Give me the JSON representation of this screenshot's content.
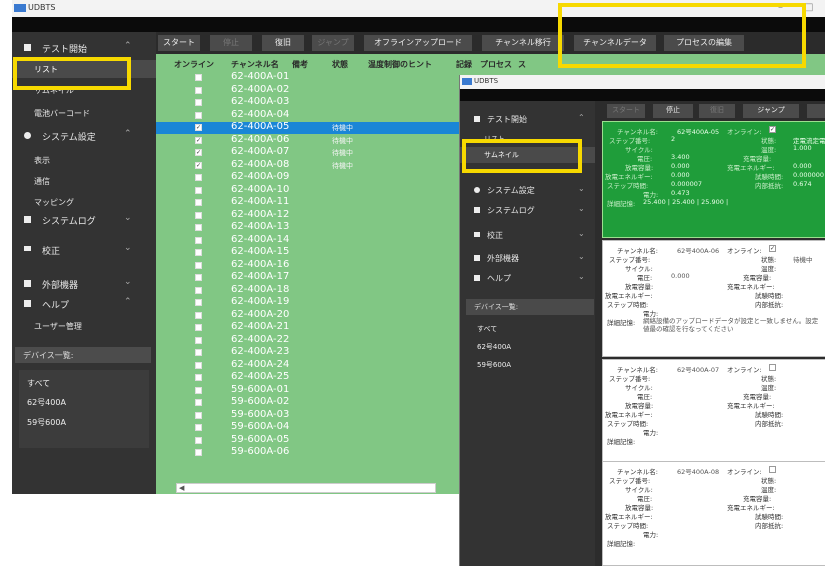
{
  "window": {
    "app_title": "UDBTS"
  },
  "sidebar": {
    "sections": [
      {
        "label": "テスト開始",
        "expanded": true
      },
      {
        "label": "システム設定",
        "expanded": true
      },
      {
        "label": "システムログ",
        "expanded": false
      },
      {
        "label": "校正",
        "expanded": false
      },
      {
        "label": "外部機器",
        "expanded": false
      },
      {
        "label": "ヘルプ",
        "expanded": true
      }
    ],
    "test_items": [
      "リスト",
      "サムネイル",
      "電池バーコード"
    ],
    "settings_items": [
      "表示",
      "通信",
      "マッピング"
    ],
    "help_items": [
      "ユーザー管理"
    ],
    "device_list_title": "デバイス一覧:",
    "devices": [
      "すべて",
      "62号400A",
      "59号600A"
    ]
  },
  "toolbar": {
    "buttons": [
      "スタート",
      "停止",
      "復旧",
      "ジャンプ",
      "オフラインアップロード",
      "チャンネル移行",
      "チャンネルデータ",
      "プロセスの編集"
    ]
  },
  "table": {
    "columns": [
      "オンライン",
      "チャンネル名",
      "備考",
      "状態",
      "温度制御のヒント",
      "記録",
      "プロセス",
      "ス"
    ],
    "rows": [
      {
        "name": "62-400A-01",
        "checked": false,
        "status": "",
        "selected": false
      },
      {
        "name": "62-400A-02",
        "checked": false,
        "status": "",
        "selected": false
      },
      {
        "name": "62-400A-03",
        "checked": false,
        "status": "",
        "selected": false
      },
      {
        "name": "62-400A-04",
        "checked": false,
        "status": "",
        "selected": false
      },
      {
        "name": "62-400A-05",
        "checked": true,
        "status": "待機中",
        "selected": true
      },
      {
        "name": "62-400A-06",
        "checked": true,
        "status": "待機中",
        "selected": false
      },
      {
        "name": "62-400A-07",
        "checked": true,
        "status": "待機中",
        "selected": false
      },
      {
        "name": "62-400A-08",
        "checked": true,
        "status": "待機中",
        "selected": false
      },
      {
        "name": "62-400A-09",
        "checked": false,
        "status": "",
        "selected": false
      },
      {
        "name": "62-400A-10",
        "checked": false,
        "status": "",
        "selected": false
      },
      {
        "name": "62-400A-11",
        "checked": false,
        "status": "",
        "selected": false
      },
      {
        "name": "62-400A-12",
        "checked": false,
        "status": "",
        "selected": false
      },
      {
        "name": "62-400A-13",
        "checked": false,
        "status": "",
        "selected": false
      },
      {
        "name": "62-400A-14",
        "checked": false,
        "status": "",
        "selected": false
      },
      {
        "name": "62-400A-15",
        "checked": false,
        "status": "",
        "selected": false
      },
      {
        "name": "62-400A-16",
        "checked": false,
        "status": "",
        "selected": false
      },
      {
        "name": "62-400A-17",
        "checked": false,
        "status": "",
        "selected": false
      },
      {
        "name": "62-400A-18",
        "checked": false,
        "status": "",
        "selected": false
      },
      {
        "name": "62-400A-19",
        "checked": false,
        "status": "",
        "selected": false
      },
      {
        "name": "62-400A-20",
        "checked": false,
        "status": "",
        "selected": false
      },
      {
        "name": "62-400A-21",
        "checked": false,
        "status": "",
        "selected": false
      },
      {
        "name": "62-400A-22",
        "checked": false,
        "status": "",
        "selected": false
      },
      {
        "name": "62-400A-23",
        "checked": false,
        "status": "",
        "selected": false
      },
      {
        "name": "62-400A-24",
        "checked": false,
        "status": "",
        "selected": false
      },
      {
        "name": "62-400A-25",
        "checked": false,
        "status": "",
        "selected": false
      },
      {
        "name": "59-600A-01",
        "checked": false,
        "status": "",
        "selected": false
      },
      {
        "name": "59-600A-02",
        "checked": false,
        "status": "",
        "selected": false
      },
      {
        "name": "59-600A-03",
        "checked": false,
        "status": "",
        "selected": false
      },
      {
        "name": "59-600A-04",
        "checked": false,
        "status": "",
        "selected": false
      },
      {
        "name": "59-600A-05",
        "checked": false,
        "status": "",
        "selected": false
      },
      {
        "name": "59-600A-06",
        "checked": false,
        "status": "",
        "selected": false
      }
    ]
  },
  "overlay": {
    "app_title": "UDBTS",
    "sections": [
      {
        "label": "テスト開始"
      },
      {
        "label": "システム設定"
      },
      {
        "label": "システムログ"
      },
      {
        "label": "校正"
      },
      {
        "label": "外部機器"
      },
      {
        "label": "ヘルプ"
      }
    ],
    "test_items": [
      "リスト",
      "サムネイル"
    ],
    "device_list_title": "デバイス一覧:",
    "devices": [
      "すべて",
      "62号400A",
      "59号600A"
    ],
    "toolbar_buttons": [
      "スタート",
      "停止",
      "復旧",
      "ジャンプ"
    ],
    "labels": {
      "channel_name": "チャンネル名:",
      "online": "オンライン:",
      "step_no": "ステップ番号:",
      "status": "状態:",
      "cycle": "サイクル:",
      "temperature": "温度:",
      "voltage": "電圧:",
      "charge_capacity": "充電容量:",
      "discharge_capacity": "放電容量:",
      "charge_energy": "充電エネルギー:",
      "discharge_energy": "放電エネルギー:",
      "elapsed_time": "試験時間:",
      "step_time": "ステップ時間:",
      "internal_resistance": "内部抵抗:",
      "power": "電力:",
      "detail": "詳細記憶:"
    },
    "cards": [
      {
        "channel": "62号400A-05",
        "online": true,
        "step": "2",
        "status": "定電流定電",
        "cycle": "",
        "temperature": "1.000",
        "voltage": "3.400",
        "charge_capacity": "",
        "discharge_capacity": "0.000",
        "charge_energy": "0.000",
        "discharge_energy": "0.000",
        "elapsed_time": "0.000000",
        "step_time": "0.000007",
        "internal_resistance": "0.674",
        "power": "0.473",
        "detail": "25.400 | 25.400 | 25.900 |",
        "active": true
      },
      {
        "channel": "62号400A-06",
        "online": true,
        "status": "待機中",
        "voltage": "0.000",
        "detail": "網絡設備のアップロードデータが設定と一致しません。設定値最の確認を行なってください",
        "active": false
      },
      {
        "channel": "62号400A-07",
        "online": false,
        "active": false
      },
      {
        "channel": "62号400A-08",
        "online": false,
        "active": false
      }
    ]
  },
  "colors": {
    "table_green": "#81c784",
    "selection_blue": "#1a86d6",
    "highlight": "#f7d900",
    "card_green": "#1f9d3a"
  }
}
